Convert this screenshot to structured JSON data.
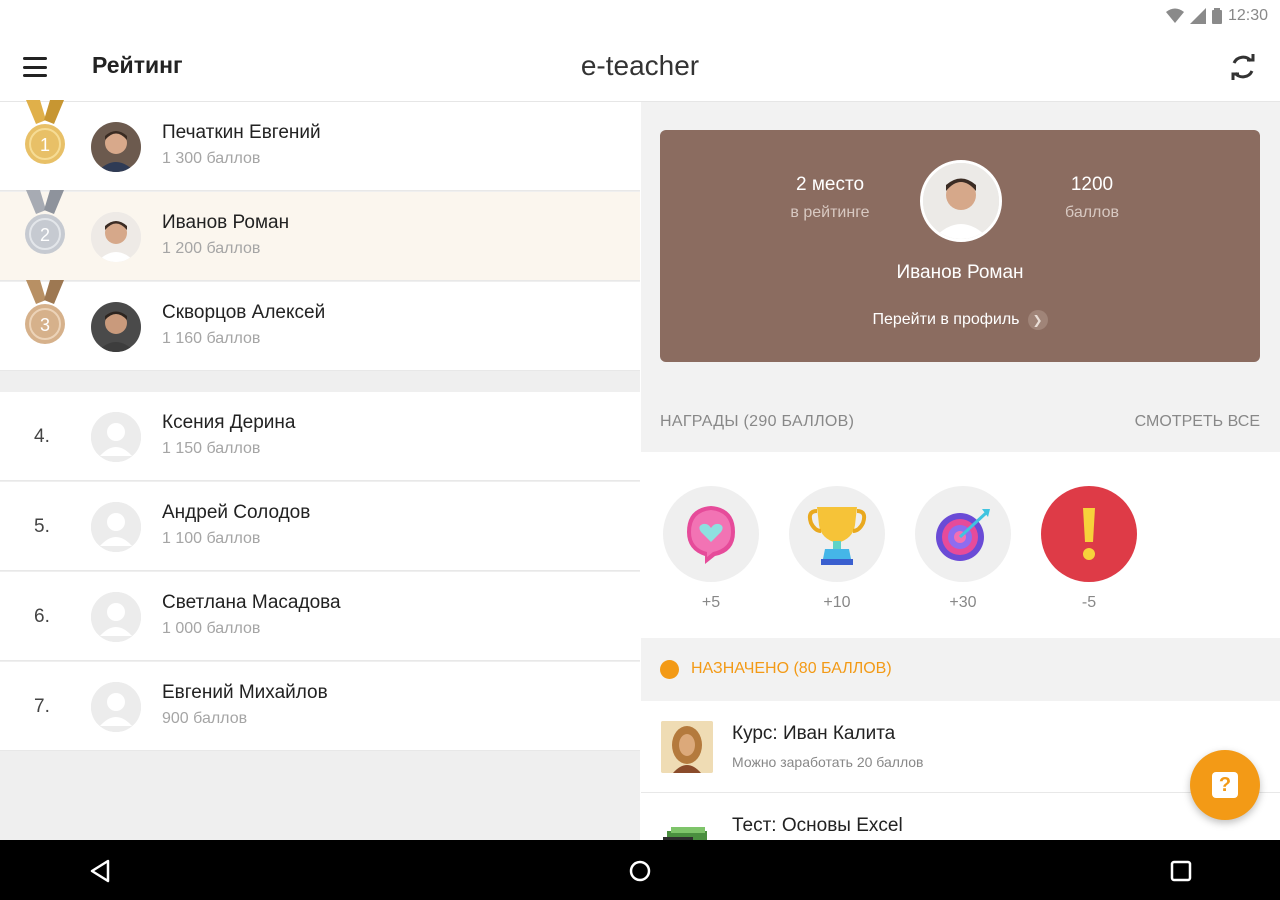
{
  "status": {
    "time": "12:30"
  },
  "appbar": {
    "page_title": "Рейтинг",
    "app_name": "e-teacher"
  },
  "leaderboard": {
    "top": [
      {
        "rank": "1",
        "name": "Печаткин Евгений",
        "points": "1 300 баллов",
        "medal": "gold"
      },
      {
        "rank": "2",
        "name": "Иванов Роман",
        "points": "1 200 баллов",
        "medal": "silver",
        "selected": true
      },
      {
        "rank": "3",
        "name": "Скворцов Алексей",
        "points": "1 160 баллов",
        "medal": "bronze"
      }
    ],
    "others": [
      {
        "rank": "4.",
        "name": "Ксения Дерина",
        "points": "1 150 баллов"
      },
      {
        "rank": "5.",
        "name": "Андрей Солодов",
        "points": "1 100 баллов"
      },
      {
        "rank": "6.",
        "name": "Светлана Масадова",
        "points": "1 000 баллов"
      },
      {
        "rank": "7.",
        "name": "Евгений Михайлов",
        "points": "900 баллов"
      }
    ]
  },
  "profile_card": {
    "place": "2 место",
    "place_sub": "в рейтинге",
    "score": "1200",
    "score_sub": "баллов",
    "name": "Иванов Роман",
    "profile_link": "Перейти в профиль"
  },
  "rewards": {
    "title": "НАГРАДЫ (290 БАЛЛОВ)",
    "see_all": "СМОТРЕТЬ ВСЕ",
    "items": [
      {
        "icon": "heart-chat-icon",
        "value": "+5"
      },
      {
        "icon": "trophy-icon",
        "value": "+10"
      },
      {
        "icon": "target-icon",
        "value": "+30"
      },
      {
        "icon": "exclamation-icon",
        "value": "-5"
      }
    ]
  },
  "assigned": {
    "title": "НАЗНАЧЕНО (80 БАЛЛОВ)",
    "tasks": [
      {
        "title": "Курс: Иван Калита",
        "subtitle": "Можно заработать 20 баллов"
      },
      {
        "title": "Тест: Основы Excel",
        "subtitle": ""
      }
    ]
  },
  "colors": {
    "accent": "#f39a16",
    "card": "#8b6c60",
    "gold": "#d9a441",
    "silver": "#b4b8c0",
    "bronze": "#c49a72"
  }
}
